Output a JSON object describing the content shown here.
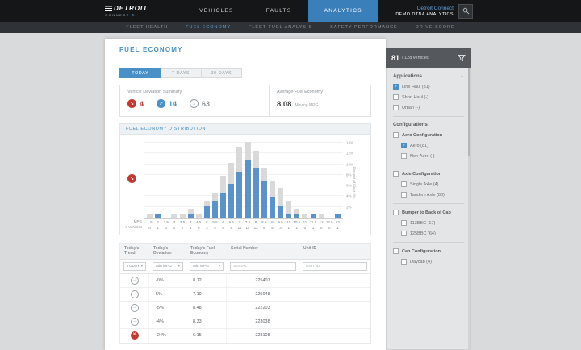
{
  "topbar": {
    "logo_primary": "DETROIT",
    "logo_secondary": "CONNECT",
    "nav": [
      {
        "label": "VEHICLES",
        "active": false
      },
      {
        "label": "FAULTS",
        "active": false
      },
      {
        "label": "ANALYTICS",
        "active": true
      }
    ],
    "account": {
      "line1": "Detroit Connect",
      "line2": "DEMO DTNA ANALYTICS"
    }
  },
  "subnav": {
    "items": [
      {
        "label": "FLEET HEALTH",
        "active": false
      },
      {
        "label": "FUEL ECONOMY",
        "active": true
      },
      {
        "label": "FLEET FUEL ANALYSIS",
        "active": false
      },
      {
        "label": "SAFETY PERFORMANCE",
        "active": false
      },
      {
        "label": "DRIVE SCORE",
        "active": false
      }
    ]
  },
  "page": {
    "title": "FUEL ECONOMY"
  },
  "tabs": [
    {
      "label": "TODAY",
      "active": true
    },
    {
      "label": "7 DAYS",
      "active": false
    },
    {
      "label": "30 DAYS",
      "active": false
    }
  ],
  "summary": {
    "deviation_title": "Vehicle Deviation Summary",
    "trends": [
      {
        "icon": "trend-down-icon",
        "glyph": "↘",
        "count": "4",
        "style": "down"
      },
      {
        "icon": "trend-up-icon",
        "glyph": "↗",
        "count": "14",
        "style": "up"
      },
      {
        "icon": "trend-steady-icon",
        "glyph": "→",
        "count": "63",
        "style": "steady"
      }
    ],
    "avg_title": "Average Fuel Economy",
    "avg_value": "8.08",
    "avg_unit": "Moving MPG"
  },
  "distribution": {
    "header": "FUEL ECONOMY DISTRIBUTION",
    "x_label_mpg": "MPG",
    "x_label_vehicles": "# Vehicles",
    "y_axis_label": "Percent of Fleet (%)"
  },
  "chart_data": {
    "type": "bar",
    "title": "Fuel Economy Distribution",
    "xlabel": "MPG",
    "ylabel": "Percent of Fleet (%)",
    "ylim": [
      0,
      14
    ],
    "y_ticks_percent": [
      2,
      4,
      6,
      8,
      10,
      12,
      14
    ],
    "categories_mpg": [
      "1.5",
      "2",
      "2.5",
      "3",
      "3.5",
      "4",
      "4.5",
      "5",
      "5.5",
      "6",
      "6.5",
      "7",
      "7.5",
      "8",
      "8.5",
      "9",
      "9.5",
      "10",
      "10.5",
      "11",
      "11.5",
      "12",
      "12.5",
      "13"
    ],
    "series": [
      {
        "name": "all-vehicles",
        "color": "#d9d9d9",
        "percent": [
          0.8,
          0.8,
          0,
          0.8,
          0.8,
          1.6,
          0.8,
          3.1,
          4.7,
          7.8,
          10.2,
          13.3,
          14.1,
          12.5,
          9.4,
          7.0,
          5.5,
          3.1,
          1.6,
          0.8,
          0.8,
          0.8,
          0,
          0.8
        ]
      },
      {
        "name": "filtered-vehicles",
        "color": "#5b93c9",
        "percent": [
          0,
          0.8,
          0,
          0,
          0,
          0.8,
          0,
          2.3,
          3.1,
          4.7,
          6.3,
          8.6,
          10.9,
          9.4,
          7.0,
          3.9,
          2.3,
          0.8,
          0.8,
          0,
          0.8,
          0,
          0,
          0.8
        ]
      }
    ],
    "vehicle_counts": [
      0,
      1,
      0,
      0,
      0,
      1,
      0,
      3,
      4,
      6,
      8,
      11,
      14,
      12,
      9,
      5,
      3,
      1,
      1,
      0,
      1,
      0,
      0,
      1
    ]
  },
  "table": {
    "columns": [
      "Today's Trend",
      "Today's Deviation",
      "Today's Fuel Economy",
      "Serial Number",
      "Unit ID"
    ],
    "filters": {
      "trend_value": "TODAY",
      "deviation_value": "Min MPG",
      "economy_value": "Min MPG",
      "serial_placeholder": "SERIAL",
      "unit_placeholder": "UNIT ID"
    },
    "rows": [
      {
        "trend": "steady",
        "deviation": "-0%",
        "economy": "8.12",
        "serial": "225407",
        "unit": ""
      },
      {
        "trend": "steady",
        "deviation": "5%",
        "economy": "7.19",
        "serial": "225048",
        "unit": ""
      },
      {
        "trend": "steady",
        "deviation": "-5%",
        "economy": "8.48",
        "serial": "222203",
        "unit": ""
      },
      {
        "trend": "steady",
        "deviation": "-4%",
        "economy": "8.33",
        "serial": "223038",
        "unit": ""
      },
      {
        "trend": "down",
        "deviation": "-24%",
        "economy": "6.15",
        "serial": "223108",
        "unit": ""
      }
    ]
  },
  "sidebar": {
    "count_bold": "81",
    "count_rest": "/ 128 vehicles",
    "applications": {
      "title": "Applications",
      "items": [
        {
          "label": "Line Haul (81)",
          "checked": true
        },
        {
          "label": "Short Haul (-)",
          "checked": false
        },
        {
          "label": "Urban (-)",
          "checked": false
        }
      ]
    },
    "configurations_label": "Configurations:",
    "groups": [
      {
        "title": "Aero Configuration",
        "checked": false,
        "items": [
          {
            "label": "Aero (81)",
            "checked": true
          },
          {
            "label": "Non-Aero (-)",
            "checked": false
          }
        ]
      },
      {
        "title": "Axle Configuration",
        "checked": false,
        "items": [
          {
            "label": "Single Axle (4)",
            "checked": false
          },
          {
            "label": "Tandem Axle (88)",
            "checked": false
          }
        ]
      },
      {
        "title": "Bumper to Back of Cab",
        "checked": false,
        "items": [
          {
            "label": "113BBC (17)",
            "checked": false
          },
          {
            "label": "125BBC (64)",
            "checked": false
          }
        ]
      },
      {
        "title": "Cab Configuration",
        "checked": false,
        "items": [
          {
            "label": "Daycab (4)",
            "checked": false
          }
        ]
      }
    ]
  },
  "colors": {
    "accent_blue": "#4a90c8",
    "alert_red": "#bf3a32",
    "neutral_gray": "#9aa0a5",
    "topbar_bg": "#141618",
    "active_tab_bg": "#3b7fba"
  }
}
